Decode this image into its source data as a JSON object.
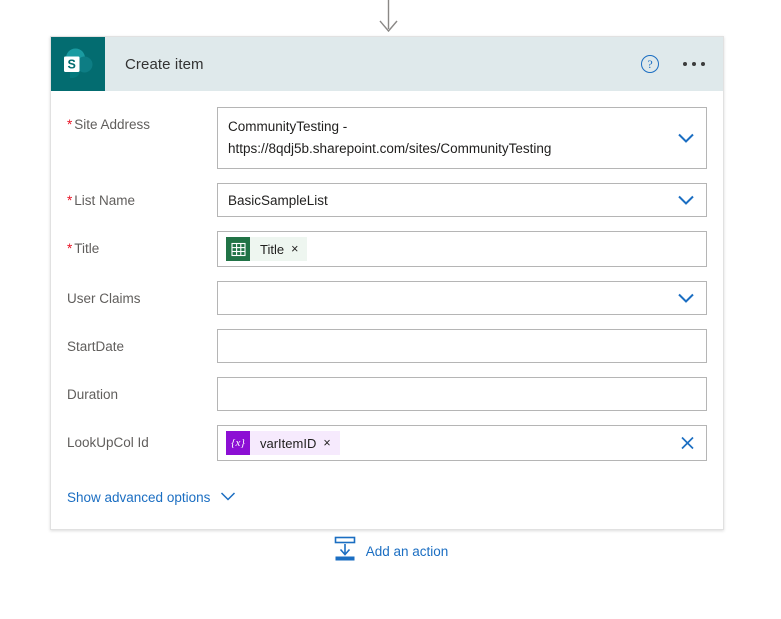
{
  "connector": {
    "icon": "arrow-down-icon"
  },
  "card": {
    "app_icon": "sharepoint-icon",
    "title": "Create item",
    "help_icon": "help-circle-icon",
    "help_glyph": "?",
    "more_icon": "more-options-icon",
    "fields": [
      {
        "label": "Site Address",
        "required": true,
        "type": "dropdown-multiline",
        "value_line1": "CommunityTesting -",
        "value_line2": "https://8qdj5b.sharepoint.com/sites/CommunityTesting",
        "icon": "chevron-down-icon"
      },
      {
        "label": "List Name",
        "required": true,
        "type": "dropdown",
        "value": "BasicSampleList",
        "icon": "chevron-down-icon"
      },
      {
        "label": "Title",
        "required": true,
        "type": "token",
        "token": {
          "kind": "excel",
          "icon": "excel-icon",
          "label": "Title",
          "remove": "×"
        }
      },
      {
        "label": "User Claims",
        "required": false,
        "type": "dropdown",
        "value": "",
        "icon": "chevron-down-icon"
      },
      {
        "label": "StartDate",
        "required": false,
        "type": "text",
        "value": ""
      },
      {
        "label": "Duration",
        "required": false,
        "type": "text",
        "value": ""
      },
      {
        "label": "LookUpCol Id",
        "required": false,
        "type": "token-clear",
        "token": {
          "kind": "variable",
          "icon": "variable-icon",
          "glyph": "{x}",
          "label": "varItemID",
          "remove": "×"
        },
        "icon": "clear-x-icon"
      }
    ],
    "advanced": {
      "label": "Show advanced options",
      "icon": "chevron-down-icon"
    }
  },
  "footer": {
    "add_action_label": "Add an action",
    "add_action_icon": "insert-below-icon"
  },
  "colors": {
    "sharepoint_teal": "#036C70",
    "header_bg": "#DFE9EB",
    "link_blue": "#1B6EC2",
    "required_red": "#E81123",
    "excel_green": "#217346",
    "variable_purple": "#8C0FD4"
  }
}
